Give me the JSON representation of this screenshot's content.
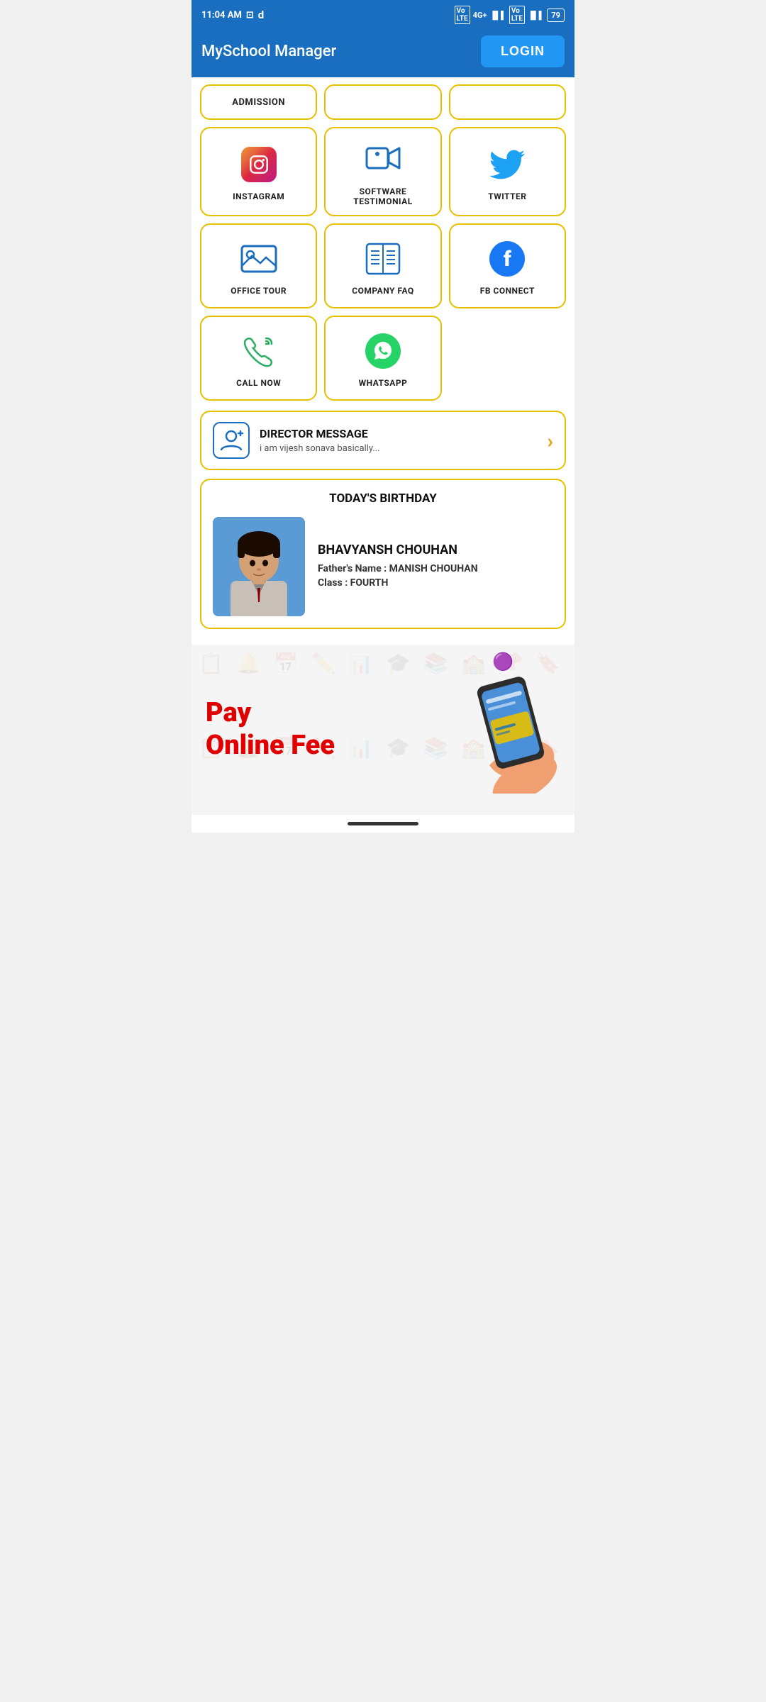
{
  "status_bar": {
    "time": "11:04 AM",
    "battery": "79",
    "signal": "4G+"
  },
  "header": {
    "title": "MySchool Manager",
    "login_label": "LOGIN"
  },
  "top_row": [
    {
      "id": "admission",
      "label": "ADMISSION"
    },
    {
      "id": "top2",
      "label": ""
    },
    {
      "id": "top3",
      "label": ""
    }
  ],
  "grid_row1": [
    {
      "id": "instagram",
      "label": "INSTAGRAM",
      "icon": "instagram"
    },
    {
      "id": "software_testimonial",
      "label": "SOFTWARE\nTESTIMONIAL",
      "icon": "video"
    },
    {
      "id": "twitter",
      "label": "TWITTER",
      "icon": "twitter"
    }
  ],
  "grid_row2": [
    {
      "id": "office_tour",
      "label": "OFFICE TOUR",
      "icon": "image"
    },
    {
      "id": "company_faq",
      "label": "COMPANY FAQ",
      "icon": "book"
    },
    {
      "id": "fb_connect",
      "label": "FB CONNECT",
      "icon": "facebook"
    }
  ],
  "grid_row3": [
    {
      "id": "call_now",
      "label": "CALL NOW",
      "icon": "phone"
    },
    {
      "id": "whatsapp",
      "label": "WHATSAPP",
      "icon": "whatsapp"
    }
  ],
  "director_message": {
    "title": "DIRECTOR MESSAGE",
    "subtitle": "i am vijesh sonava basically...",
    "arrow": "›"
  },
  "birthday": {
    "section_title": "TODAY'S BIRTHDAY",
    "name": "BHAVYANSH CHOUHAN",
    "father_label": "Father's Name :",
    "father_value": "MANISH CHOUHAN",
    "class_label": "Class :",
    "class_value": "FOURTH"
  },
  "banner": {
    "line1": "Pay",
    "line2": "Online Fee"
  }
}
